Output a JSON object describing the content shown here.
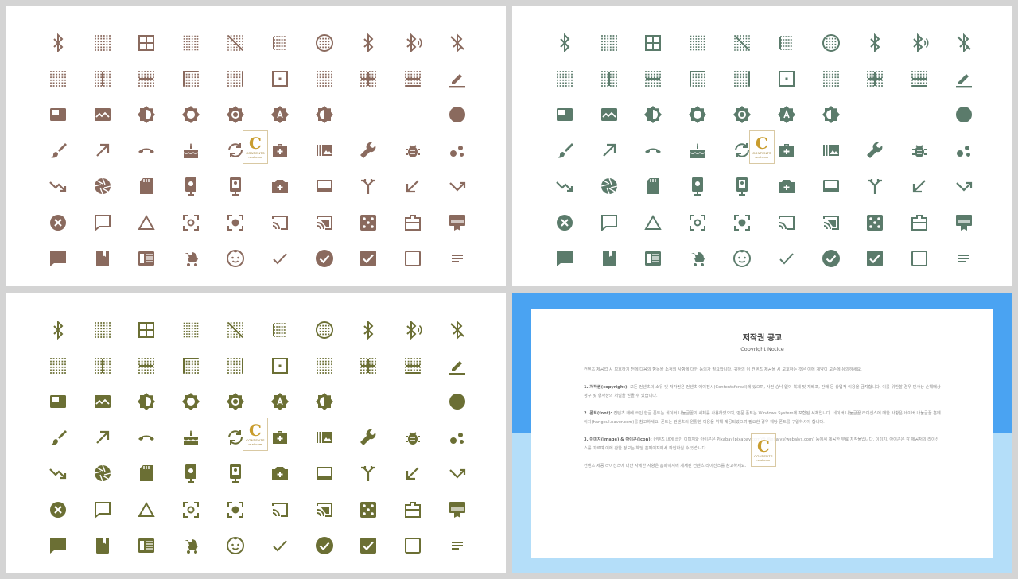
{
  "themes": [
    {
      "color": "#8a6a5e"
    },
    {
      "color": "#5b7b6b"
    },
    {
      "color": "#6b6f34"
    }
  ],
  "icon_grid": [
    [
      "bluetooth-icon",
      "dots-grid-icon",
      "border-all-icon",
      "dots-fade-icon",
      "grid-off-icon",
      "border-left-lines-icon",
      "dots-circle-icon",
      "bluetooth-icon",
      "bluetooth-audio-icon",
      "bluetooth-disabled-icon"
    ],
    [
      "border-outer-dotted-icon",
      "border-vertical-icon",
      "border-horizontal-icon",
      "border-top-left-icon",
      "border-right-dotted-icon",
      "border-inner-dot-icon",
      "border-clear-icon",
      "border-inner-icon",
      "border-bottom-center-icon",
      "edit-underline-icon"
    ],
    [
      "picture-in-picture-icon",
      "image-wave-icon",
      "brightness-half-icon",
      "brightness-sun-icon",
      "brightness-dot-icon",
      "brightness-auto-icon",
      "brightness-half-alt-icon",
      "moon-thin-icon",
      "moon-crescent-icon",
      "circle-filled-icon"
    ],
    [
      "brush-icon",
      "arrow-up-right-icon",
      "call-end-icon",
      "cake-icon",
      "refresh-cycle-icon",
      "briefcase-plus-icon",
      "burst-photo-icon",
      "wrench-icon",
      "bug-icon",
      "bubbles-icon"
    ],
    [
      "trending-down-icon",
      "camera-aperture-icon",
      "sd-card-icon",
      "phone-camera-front-icon",
      "phone-camera-rear-icon",
      "camera-plus-icon",
      "card-display-icon",
      "call-merge-icon",
      "arrow-down-left-icon",
      "call-missed-icon"
    ],
    [
      "cancel-circle-icon",
      "chat-bubble-outline-icon",
      "triangle-outline-icon",
      "center-focus-weak-icon",
      "center-focus-strong-icon",
      "cast-icon",
      "cast-connected-icon",
      "dice-icon",
      "work-outline-icon",
      "card-membership-icon"
    ],
    [
      "chat-bubble-icon",
      "book-icon",
      "article-icon",
      "stroller-icon",
      "baby-face-icon",
      "check-icon",
      "check-circle-icon",
      "checkbox-checked-icon",
      "checkbox-empty-icon",
      "short-text-icon"
    ]
  ],
  "stamp": {
    "letter": "C",
    "caption_top": "CONTENTS",
    "caption_bottom": "real.com"
  },
  "notice": {
    "title": "저작권 공고",
    "subtitle": "Copyright Notice",
    "intro": "컨텐츠 제공업 시 보호하기 전에 다음의 항목을 소정의 사항에 대한 동의가 필요합니다. 귀하의 이 컨텐츠 제공을 시 보호하는 것은 이에 계약이 보존에 유의하세요.",
    "items": [
      {
        "heading": "1. 저작권(copyright):",
        "text": "모든 컨텐츠의 소유 및 저작권은 컨텐츠 에이전시(Contentsforeal)에 있으며, 사전 승낙 없이 복제 및 재배포, 판매 등 상업적 이용을 금지합니다. 이를 위반할 경우 민사상 손해배상 청구 및 형사상의 처벌을 받을 수 있습니다."
      },
      {
        "heading": "2. 폰트(font):",
        "text": "컨텐츠 내에 쓰인 한글 폰트는 네이버 나눔글꼴의 서체를 사용하였으며, 영문 폰트는 Windows System에 포함된 서체입니다. 네이버 나눔글꼴 라이선스에 대한 사항은 네이버 나눔글꼴 홈페이지(hangeul.naver.com)를 참고하세요. 폰트는 컨텐츠의 원활한 이용을 위해 제공되었으며 필요한 경우 해당 폰트를 구입하셔야 합니다."
      },
      {
        "heading": "3. 이미지(image) & 아이콘(icon):",
        "text": "컨텐츠 내에 쓰인 이미지와 아이콘은 Pixabay(pixabay.com)와 Webalys(webalys.com) 등에서 제공한 무료 저작물입니다. 이미지, 아이콘은 각 제공처의 라이선스를 따르며 이에 관한 정보는 해당 홈페이지에서 확인하실 수 있습니다."
      }
    ],
    "outro": "컨텐츠 제공 라이선스에 대한 자세한 사항은 홈페이지에 게재된 컨텐츠 라이선스를 참고하세요."
  }
}
